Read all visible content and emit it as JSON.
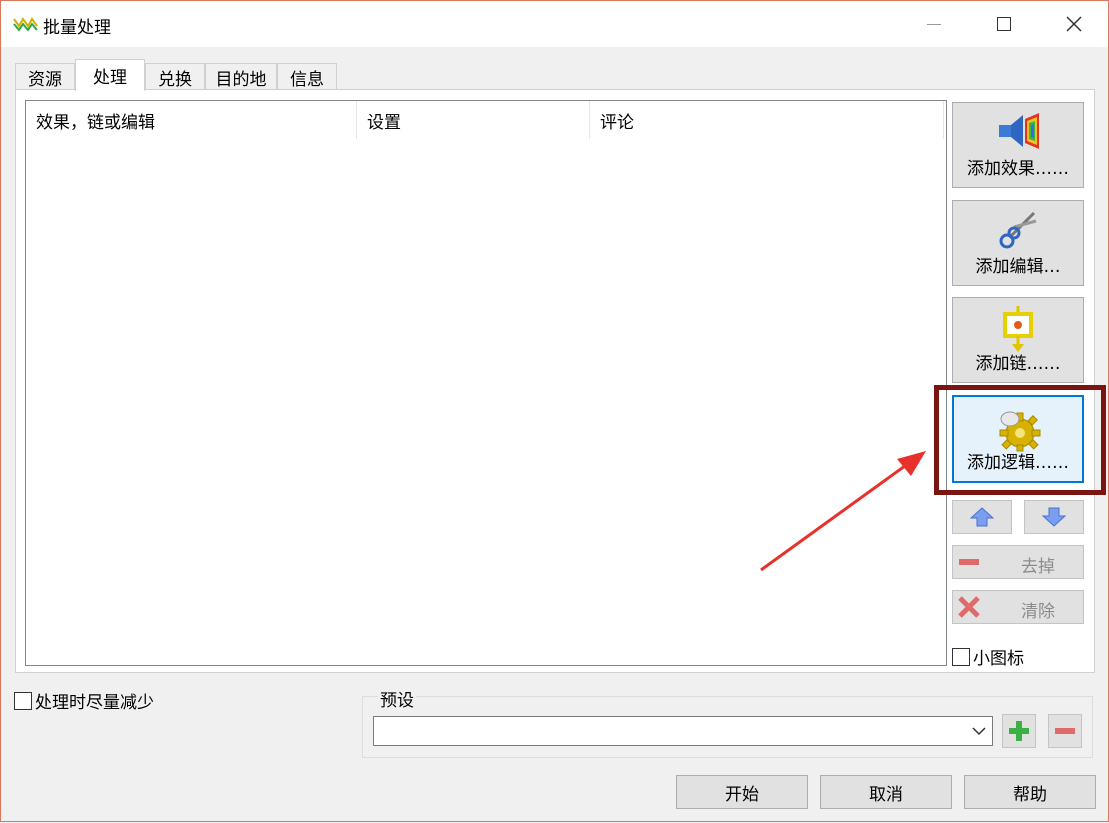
{
  "window": {
    "title": "批量处理"
  },
  "tabs": [
    {
      "label": "资源"
    },
    {
      "label": "处理"
    },
    {
      "label": "兑换"
    },
    {
      "label": "目的地"
    },
    {
      "label": "信息"
    }
  ],
  "list": {
    "columns": [
      "效果，链或编辑",
      "设置",
      "评论"
    ]
  },
  "side_buttons": {
    "add_effect": "添加效果……",
    "add_edit": "添加编辑…",
    "add_chain": "添加链……",
    "add_logic": "添加逻辑……",
    "remove": "去掉",
    "clear": "清除"
  },
  "options": {
    "small_icons": "小图标",
    "minimize_while_processing": "处理时尽量减少"
  },
  "preset": {
    "legend": "预设",
    "value": ""
  },
  "footer": {
    "start": "开始",
    "cancel": "取消",
    "help": "帮助"
  },
  "colors": {
    "highlight_box": "#7b1512",
    "annotation_arrow": "#e8312b",
    "focus_border": "#0078d7"
  }
}
